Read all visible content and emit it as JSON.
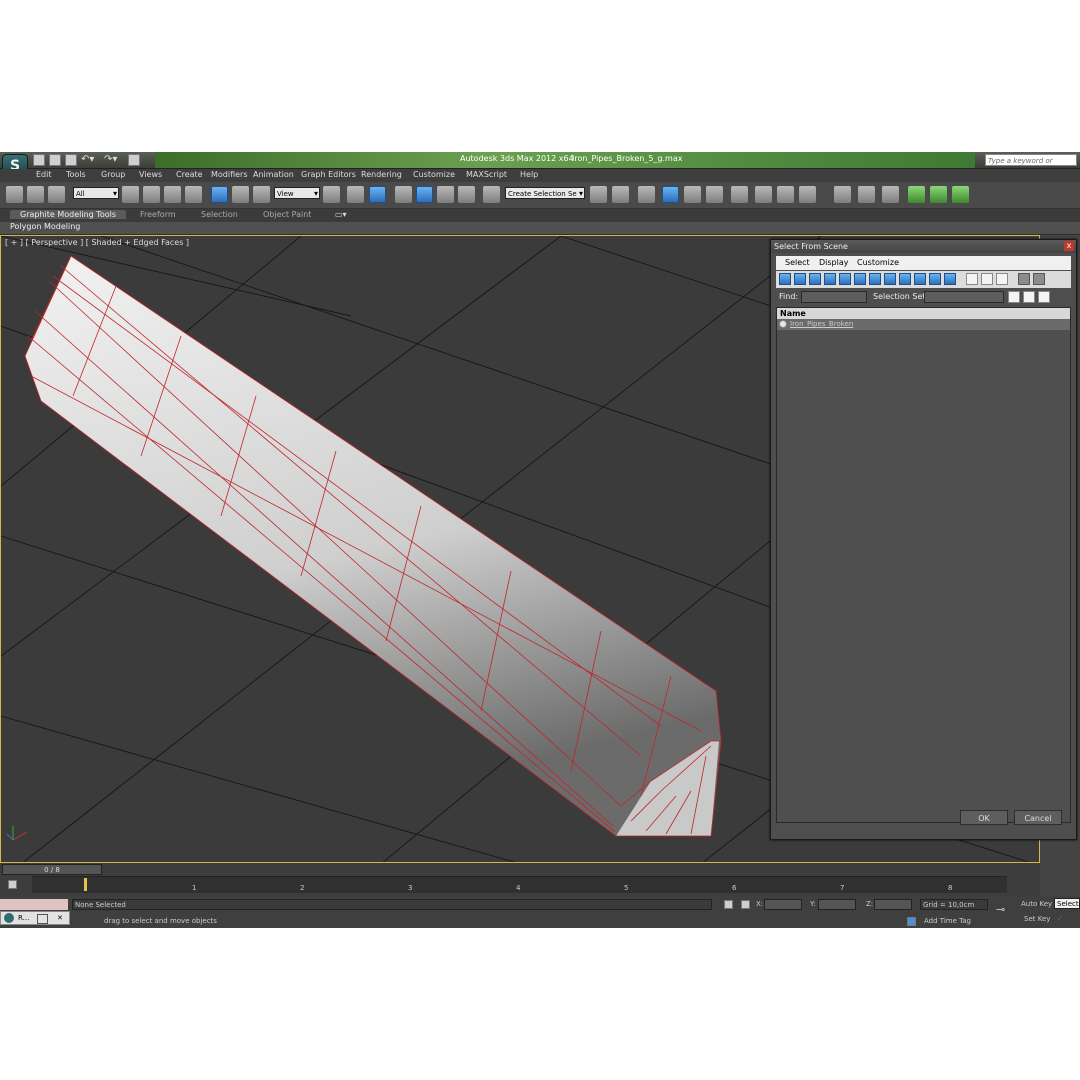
{
  "app": {
    "title": "Autodesk 3ds Max  2012 x64",
    "file_name": "Iron_Pipes_Broken_5_g.max",
    "search_placeholder": "Type a keyword or phrase",
    "logo_glyph": "S"
  },
  "menu": [
    "Edit",
    "Tools",
    "Group",
    "Views",
    "Create",
    "Modifiers",
    "Animation",
    "Graph Editors",
    "Rendering",
    "Customize",
    "MAXScript",
    "Help"
  ],
  "toolbar": {
    "selection_filter": "All",
    "reference_coord": "View",
    "named_selection": "Create Selection Se",
    "snap_label": "3",
    "angle_snap_label": "%"
  },
  "ribbon": {
    "tabs": [
      "Graphite Modeling Tools",
      "Freeform",
      "Selection",
      "Object Paint"
    ],
    "panel_label": "Polygon Modeling"
  },
  "viewport": {
    "label": "[ + ] [ Perspective ] [ Shaded + Edged Faces ]",
    "wire_color": "#c0262a",
    "object_color": "#d0d0d0"
  },
  "dialog": {
    "title": "Select From Scene",
    "menu": [
      "Select",
      "Display",
      "Customize"
    ],
    "find_label": "Find:",
    "selection_set_label": "Selection Set:",
    "column_name": "Name",
    "items": [
      "Iron_Pipes_Broken"
    ],
    "ok_label": "OK",
    "cancel_label": "Cancel",
    "close_glyph": "x"
  },
  "timeline": {
    "frame_counter": "0 / 8",
    "ticks": [
      "1",
      "2",
      "3",
      "4",
      "5",
      "6",
      "7",
      "8"
    ]
  },
  "status": {
    "selection": "None Selected",
    "prompt": "drag to select and move objects",
    "x_label": "X:",
    "y_label": "Y:",
    "z_label": "Z:",
    "grid": "Grid = 10,0cm",
    "auto_key": "Auto Key",
    "set_key": "Set Key",
    "add_time_tag": "Add Time Tag",
    "key_filter": "Selected",
    "taskbar_label": "R..."
  }
}
